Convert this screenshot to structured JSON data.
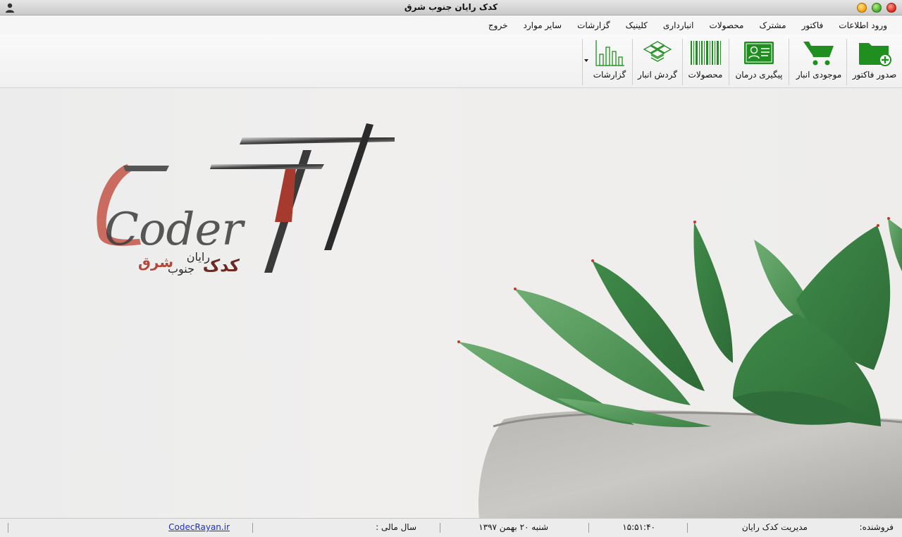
{
  "window": {
    "title": "کدک رایان جنوب شرق"
  },
  "menu": [
    {
      "label": "ورود اطلاعات"
    },
    {
      "label": "فاکتور"
    },
    {
      "label": "مشترک"
    },
    {
      "label": "محصولات"
    },
    {
      "label": "انبارداری"
    },
    {
      "label": "کلینیک"
    },
    {
      "label": "گزارشات"
    },
    {
      "label": "سایر موارد"
    },
    {
      "label": "خروج"
    }
  ],
  "toolbar": {
    "items": [
      {
        "label": "صدور فاکتور",
        "icon": "folder-add-icon"
      },
      {
        "label": "موجودی انبار",
        "icon": "shopping-cart-icon"
      },
      {
        "label": "پیگیری درمان",
        "icon": "patient-card-icon"
      },
      {
        "label": "محصولات",
        "icon": "barcode-icon"
      },
      {
        "label": "گردش انبار",
        "icon": "boxes-icon"
      },
      {
        "label": "گزارشات",
        "icon": "bar-chart-icon"
      }
    ]
  },
  "logo": {
    "text_en": "Coder",
    "text_fa_1": "کدک",
    "text_fa_2": "رایان",
    "text_fa_3": "جنوب",
    "text_fa_4": "شرق"
  },
  "status": {
    "seller_label": "فروشنده:",
    "seller_value": "مدیریت کدک رایان",
    "time": "۱۵:۵۱:۴۰",
    "date": "شنبه ۲۰ بهمن ۱۳۹۷",
    "fiscal_year_label": "سال مالی :",
    "website": "CodecRayan.ir"
  },
  "colors": {
    "icon_green": "#1f8f1f",
    "logo_red": "#b5473a",
    "link_blue": "#1a2fd0"
  }
}
